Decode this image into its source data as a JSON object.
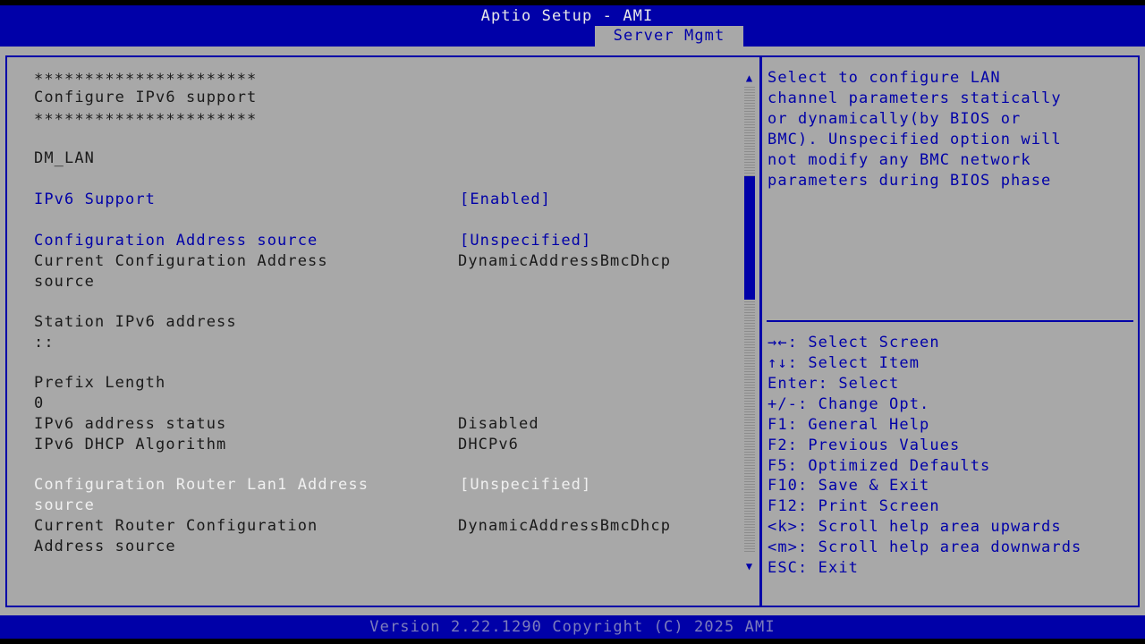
{
  "header": {
    "title": "Aptio Setup - AMI",
    "active_tab": "Server Mgmt"
  },
  "settings": {
    "stars_top": "**********************",
    "section_heading": "Configure IPv6 support",
    "stars_bottom": "**********************",
    "channel": "DM_LAN",
    "ipv6_support": {
      "label": "IPv6 Support",
      "value": "[Enabled]"
    },
    "config_address_source": {
      "label": "Configuration Address source",
      "value": "[Unspecified]"
    },
    "current_config_address_source": {
      "label_line1": "Current Configuration Address",
      "label_line2": "source",
      "value": "DynamicAddressBmcDhcp"
    },
    "station_ipv6_address": {
      "label": "Station IPv6 address",
      "value": "::"
    },
    "prefix_length": {
      "label": "Prefix Length",
      "value": "0"
    },
    "ipv6_address_status": {
      "label": "IPv6 address status",
      "value": "Disabled"
    },
    "ipv6_dhcp_algorithm": {
      "label": "IPv6 DHCP Algorithm",
      "value": "DHCPv6"
    },
    "config_router_lan1_address_source": {
      "label_line1": "Configuration Router Lan1 Address",
      "label_line2": "source",
      "value": "[Unspecified]"
    },
    "current_router_config_address_source": {
      "label_line1": "Current Router Configuration",
      "label_line2": "Address source",
      "value": "DynamicAddressBmcDhcp"
    }
  },
  "help_text": [
    "Select to configure LAN",
    "channel parameters statically",
    "or dynamically(by BIOS or",
    "BMC). Unspecified option will",
    "not modify any BMC network",
    "parameters during BIOS phase"
  ],
  "key_help": [
    "→←: Select Screen",
    "↑↓: Select Item",
    "Enter: Select",
    "+/-: Change Opt.",
    "F1: General Help",
    "F2: Previous Values",
    "F5: Optimized Defaults",
    "F10: Save & Exit",
    "F12: Print Screen",
    "<k>: Scroll help area upwards",
    "<m>: Scroll help area downwards",
    "ESC: Exit"
  ],
  "scrollbar": {
    "up_glyph": "▲",
    "down_glyph": "▼",
    "position_fraction": 0.26
  },
  "footer": {
    "version": "Version 2.22.1290 Copyright (C) 2025 AMI"
  },
  "colors": {
    "header_bg": "#0000a8",
    "panel_bg": "#a8a8a8",
    "selectable_text": "#0000a8",
    "highlighted_text": "#f0f0f0",
    "static_text": "#1a1a1a"
  }
}
